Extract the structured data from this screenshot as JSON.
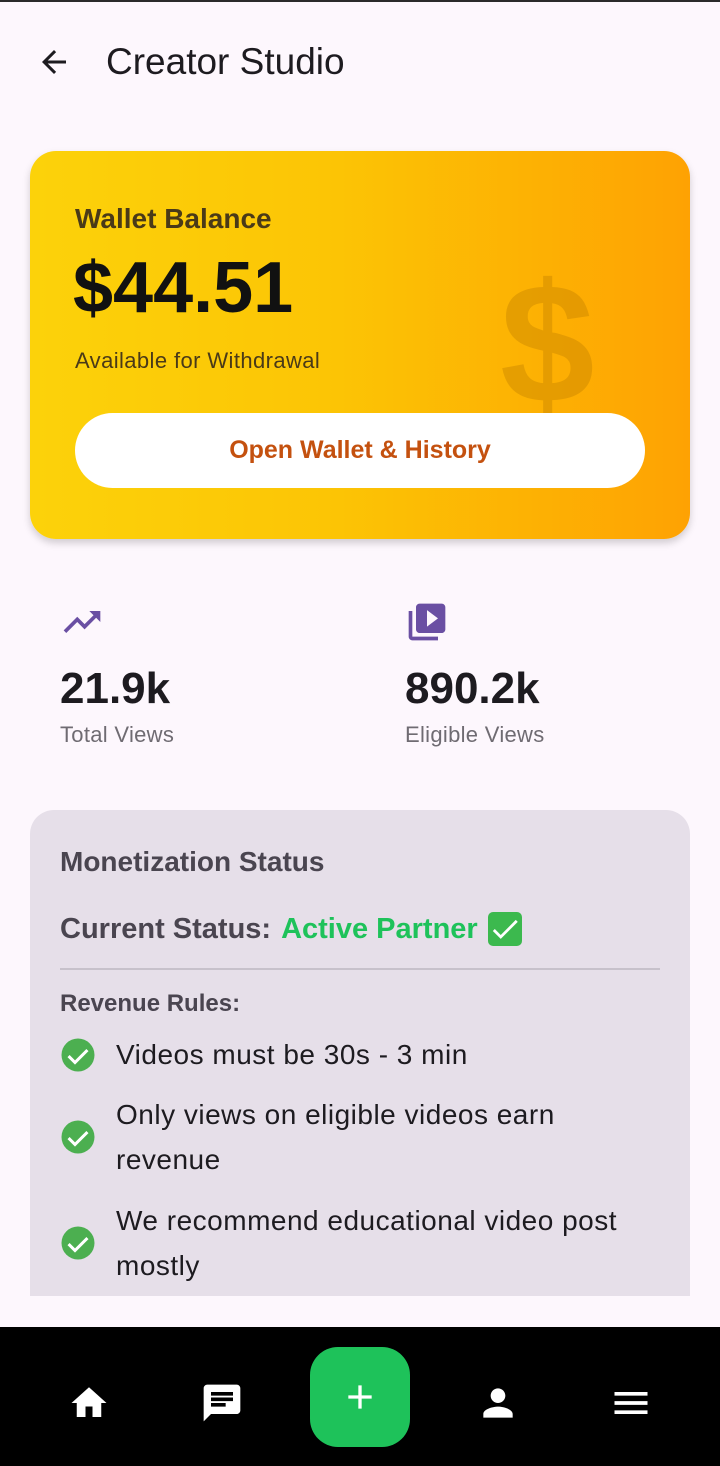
{
  "header": {
    "title": "Creator Studio",
    "back_icon": "arrow-left-icon"
  },
  "wallet": {
    "label": "Wallet Balance",
    "amount": "$44.51",
    "subtitle": "Available for Withdrawal",
    "decor_symbol": "$",
    "button_label": "Open Wallet & History",
    "colors": {
      "gradient_start": "#fcd20a",
      "gradient_end": "#fea203",
      "button_text": "#c4510f"
    }
  },
  "stats": [
    {
      "icon": "trending-up-icon",
      "value": "21.9k",
      "label": "Total Views"
    },
    {
      "icon": "video-library-icon",
      "value": "890.2k",
      "label": "Eligible Views"
    }
  ],
  "monetization": {
    "title": "Monetization Status",
    "status_label": "Current Status:",
    "status_value": "Active Partner",
    "status_icon": "check-mark-button-icon",
    "rules_title": "Revenue Rules:",
    "rules": [
      {
        "text": "Videos must be 30s - 3 min",
        "icon": "check-circle-icon"
      },
      {
        "text": "Only views on eligible videos earn revenue",
        "icon": "check-circle-icon"
      },
      {
        "text": "We recommend educational video post mostly",
        "icon": "check-circle-icon"
      }
    ],
    "colors": {
      "active": "#1ec25a"
    }
  },
  "bottom_nav": {
    "items": [
      {
        "icon": "home-icon"
      },
      {
        "icon": "chat-icon"
      },
      {
        "icon": "plus-icon"
      },
      {
        "icon": "person-icon"
      },
      {
        "icon": "menu-icon"
      }
    ],
    "colors": {
      "fab": "#1ec25a",
      "background": "#000000"
    }
  }
}
